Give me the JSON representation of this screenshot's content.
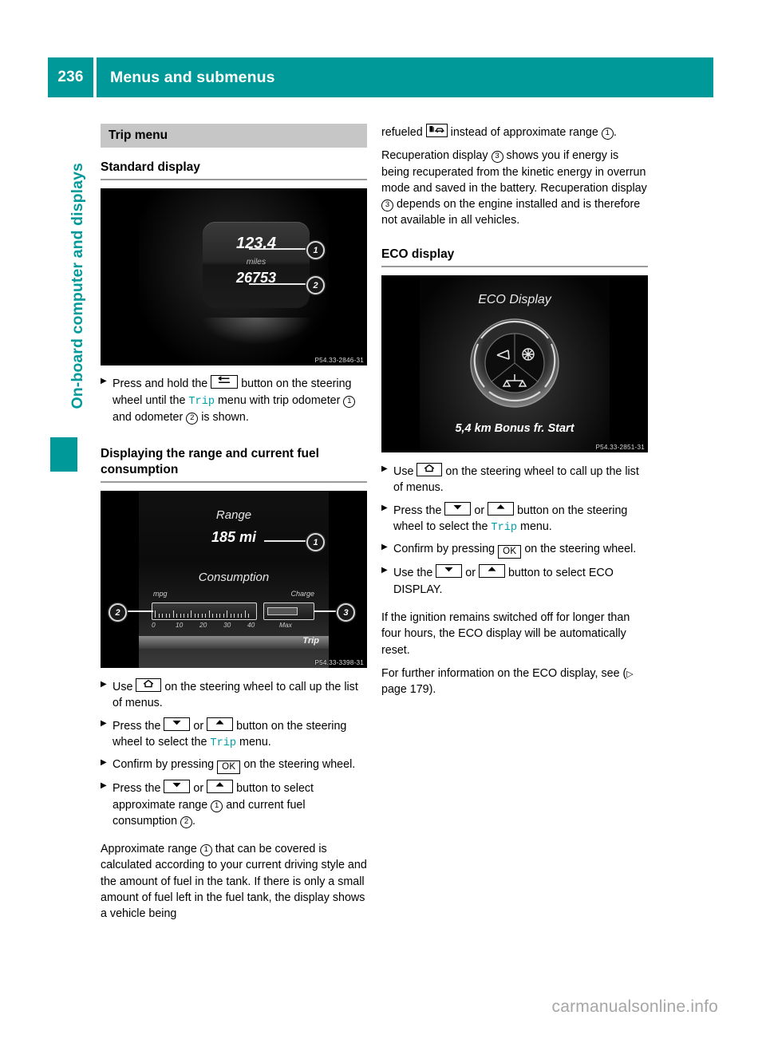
{
  "header": {
    "page_number": "236",
    "title": "Menus and submenus",
    "accent_color": "#009999"
  },
  "side_tab": {
    "label": "On-board computer and displays"
  },
  "left_column": {
    "chapter_bar": "Trip menu",
    "heading_1": "Standard display",
    "figure_1": {
      "code": "P54.33-2846-31",
      "trip_odometer_value": "123.4",
      "unit": "miles",
      "odometer_value": "26753",
      "callout_1": "1",
      "callout_2": "2"
    },
    "bullet_1": {
      "pre": "Press and hold the",
      "key": "back-key",
      "mid": "button on the steering wheel until the",
      "trip": "Trip",
      "post_a": "menu with trip odometer",
      "c1": "1",
      "post_b": "and odometer",
      "c2": "2",
      "post_c": "is shown."
    },
    "heading_2": "Displaying the range and current fuel consumption",
    "figure_2": {
      "code": "P54.33-3398-31",
      "range_label": "Range",
      "range_value": "185 mi",
      "consumption_label": "Consumption",
      "mpg_label": "mpg",
      "charge_label": "Charge",
      "scale_ticks": [
        "0",
        "10",
        "20",
        "30",
        "40"
      ],
      "max_label": "Max",
      "trip_chip": "Trip",
      "callout_1": "1",
      "callout_2": "2",
      "callout_3": "3"
    },
    "bullets": [
      {
        "pre": "Use",
        "key": "home",
        "post": "on the steering wheel to call up the list of menus."
      },
      {
        "pre": "Press the",
        "key": "down",
        "or": "or",
        "key2": "up",
        "mid": "button on the steering wheel to select the",
        "trip": "Trip",
        "post": "menu."
      },
      {
        "pre": "Confirm by pressing",
        "key": "OK",
        "post": "on the steering wheel."
      },
      {
        "pre": "Press the",
        "key": "down",
        "or": "or",
        "key2": "up",
        "mid": "button to select approximate range",
        "c1": "1",
        "mid2": "and current fuel consumption",
        "c2": "2",
        "post": "."
      }
    ],
    "paragraph": {
      "a": "Approximate range",
      "c1": "1",
      "b": "that can be covered is calculated according to your current driving style and the amount of fuel in the tank. If there is only a small amount of fuel left in the fuel tank, the display shows a vehicle being"
    }
  },
  "right_column": {
    "paragraph_1": {
      "a": "refueled",
      "icon": "refuel-vehicle-icon",
      "b": "instead of approximate range",
      "c1": "1",
      "c": "."
    },
    "paragraph_2": {
      "a": "Recuperation display",
      "c3a": "3",
      "b": "shows you if energy is being recuperated from the kinetic energy in overrun mode and saved in the battery. Recuperation display",
      "c3b": "3",
      "c": "depends on the engine installed and is therefore not available in all vehicles."
    },
    "heading": "ECO display",
    "figure_3": {
      "code": "P54.33-2851-31",
      "title": "ECO Display",
      "footer": "5,4 km Bonus fr. Start"
    },
    "bullets": [
      {
        "pre": "Use",
        "key": "home",
        "post": "on the steering wheel to call up the list of menus."
      },
      {
        "pre": "Press the",
        "key": "down",
        "or": "or",
        "key2": "up",
        "mid": "button on the steering wheel to select the",
        "trip": "Trip",
        "post": "menu."
      },
      {
        "pre": "Confirm by pressing",
        "key": "OK",
        "post": "on the steering wheel."
      },
      {
        "pre": "Use the",
        "key": "down",
        "or": "or",
        "key2": "up",
        "post": "button to select ECO DISPLAY."
      }
    ],
    "paragraph_3": "If the ignition remains switched off for longer than four hours, the ECO display will be automatically reset.",
    "paragraph_4": {
      "a": "For further information on the ECO display, see (",
      "arrow": "▷",
      "b": "page 179)."
    }
  },
  "watermark": "carmanualsonline.info"
}
